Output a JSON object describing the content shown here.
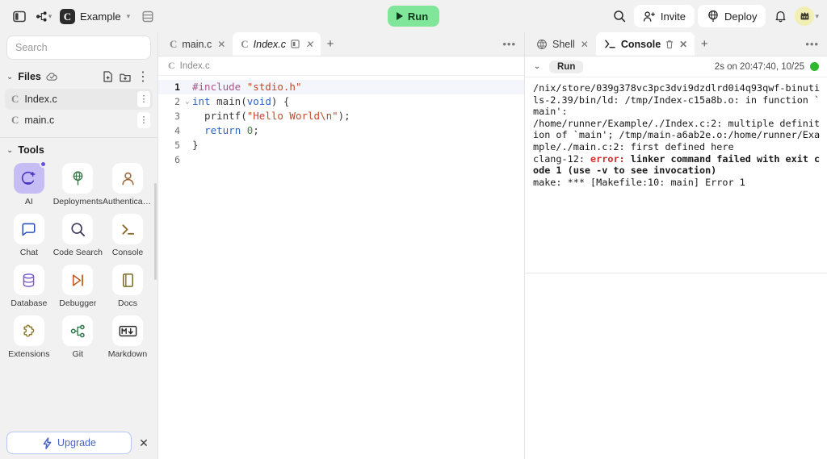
{
  "topbar": {
    "sidebar_toggle_icon": "panel-toggle-icon",
    "branch_icon": "git-branch-icon",
    "project_logo_letter": "C",
    "project_name": "Example",
    "layout_icon": "layout-icon",
    "run_label": "Run",
    "search_icon": "search-icon",
    "invite_label": "Invite",
    "deploy_label": "Deploy",
    "bell_icon": "bell-icon",
    "avatar_icon": "user-avatar",
    "avatar_chevron": "chevron-down-icon"
  },
  "sidebar": {
    "search_placeholder": "Search",
    "files_section": {
      "title": "Files",
      "cloud_icon": "cloud-check-icon",
      "new_file_icon": "new-file-icon",
      "new_folder_icon": "new-folder-icon",
      "more_icon": "kebab-menu-icon",
      "items": [
        {
          "name": "Index.c",
          "icon": "c-file-icon",
          "selected": true
        },
        {
          "name": "main.c",
          "icon": "c-file-icon",
          "selected": false
        }
      ]
    },
    "tools_section": {
      "title": "Tools",
      "items": [
        {
          "label": "AI",
          "icon": "ai-icon",
          "active": true,
          "badge": true,
          "color": "#4a35c4"
        },
        {
          "label": "Deployments",
          "icon": "deployments-icon",
          "active": false,
          "badge": false,
          "color": "#3b7a47"
        },
        {
          "label": "Authenticati...",
          "icon": "authentication-icon",
          "active": false,
          "badge": false,
          "color": "#9a6b3a"
        },
        {
          "label": "Chat",
          "icon": "chat-icon",
          "active": false,
          "badge": false,
          "color": "#2f52c0"
        },
        {
          "label": "Code Search",
          "icon": "code-search-icon",
          "active": false,
          "badge": false,
          "color": "#3a3a5a"
        },
        {
          "label": "Console",
          "icon": "console-icon",
          "active": false,
          "badge": false,
          "color": "#8a6a2a"
        },
        {
          "label": "Database",
          "icon": "database-icon",
          "active": false,
          "badge": false,
          "color": "#7a5ad0"
        },
        {
          "label": "Debugger",
          "icon": "debugger-icon",
          "active": false,
          "badge": false,
          "color": "#c2602a"
        },
        {
          "label": "Docs",
          "icon": "docs-icon",
          "active": false,
          "badge": false,
          "color": "#7a6a2a"
        },
        {
          "label": "Extensions",
          "icon": "extensions-icon",
          "active": false,
          "badge": false,
          "color": "#8a7a2a"
        },
        {
          "label": "Git",
          "icon": "git-icon",
          "active": false,
          "badge": false,
          "color": "#2f7a4a"
        },
        {
          "label": "Markdown",
          "icon": "markdown-icon",
          "active": false,
          "badge": false,
          "color": "#2b2b2b"
        }
      ]
    },
    "upgrade": {
      "label": "Upgrade",
      "icon": "lightning-icon",
      "close_icon": "close-icon"
    }
  },
  "editor": {
    "tabs": [
      {
        "label": "main.c",
        "icon": "c-file-icon",
        "active": false,
        "has_split": false
      },
      {
        "label": "Index.c",
        "icon": "c-file-icon",
        "active": true,
        "has_split": true
      }
    ],
    "add_tab_icon": "plus-icon",
    "more_icon": "ellipsis-icon",
    "breadcrumb": "Index.c",
    "breadcrumb_icon": "c-file-icon",
    "lines": [
      {
        "num": "1",
        "fold": "",
        "highlight": true,
        "tokens": [
          {
            "t": "#include ",
            "c": "k-pre"
          },
          {
            "t": "\"stdio.h\"",
            "c": "k-str"
          }
        ]
      },
      {
        "num": "2",
        "fold": "v",
        "highlight": false,
        "tokens": [
          {
            "t": "int ",
            "c": "k-type"
          },
          {
            "t": "main",
            "c": "k-plain"
          },
          {
            "t": "(",
            "c": "k-plain"
          },
          {
            "t": "void",
            "c": "k-type"
          },
          {
            "t": ") {",
            "c": "k-plain"
          }
        ]
      },
      {
        "num": "3",
        "fold": "",
        "highlight": false,
        "tokens": [
          {
            "t": "  printf(",
            "c": "k-plain"
          },
          {
            "t": "\"Hello World",
            "c": "k-str"
          },
          {
            "t": "\\n",
            "c": "k-esc"
          },
          {
            "t": "\"",
            "c": "k-str"
          },
          {
            "t": ");",
            "c": "k-plain"
          }
        ]
      },
      {
        "num": "4",
        "fold": "",
        "highlight": false,
        "tokens": [
          {
            "t": "  ",
            "c": "k-plain"
          },
          {
            "t": "return ",
            "c": "k-type"
          },
          {
            "t": "0",
            "c": "k-num"
          },
          {
            "t": ";",
            "c": "k-plain"
          }
        ]
      },
      {
        "num": "5",
        "fold": "",
        "highlight": false,
        "tokens": [
          {
            "t": "}",
            "c": "k-plain"
          }
        ]
      },
      {
        "num": "6",
        "fold": "",
        "highlight": false,
        "tokens": []
      }
    ]
  },
  "console": {
    "tabs": [
      {
        "label": "Shell",
        "icon": "shell-icon",
        "active": false,
        "has_trash": false
      },
      {
        "label": "Console",
        "icon": "terminal-icon",
        "active": true,
        "has_trash": true
      }
    ],
    "add_tab_icon": "plus-icon",
    "more_icon": "ellipsis-icon",
    "collapse_icon": "chevron-down-icon",
    "run_label": "Run",
    "run_meta": "2s on 20:47:40, 10/25",
    "status_color": "#2eb82e",
    "output_segments": [
      {
        "text": "/nix/store/039g378vc3pc3dvi9dzdlrd0i4q93qwf-binutils-2.39/bin/ld: /tmp/Index-c15a8b.o: in function `main':\n/home/runner/Example/./Index.c:2: multiple definition of `main'; /tmp/main-a6ab2e.o:/home/runner/Example/./main.c:2: first defined here\nclang-12: ",
        "style": "normal"
      },
      {
        "text": "error:",
        "style": "error"
      },
      {
        "text": " ",
        "style": "normal"
      },
      {
        "text": "linker command failed with exit code 1 (use -v to see invocation)",
        "style": "bold"
      },
      {
        "text": "\nmake: *** [Makefile:10: main] Error 1\n",
        "style": "normal"
      }
    ]
  }
}
